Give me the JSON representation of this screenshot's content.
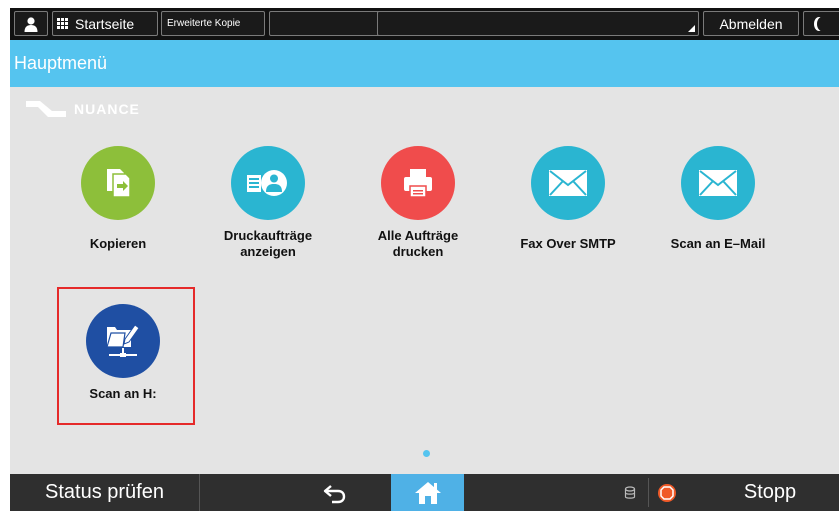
{
  "topbar": {
    "user_icon": "user-icon",
    "home_label": "Startseite",
    "copy_label": "Erweiterte Kopie",
    "logout_label": "Abmelden",
    "moon_icon": "moon-icon"
  },
  "header": {
    "title": "Hauptmenü"
  },
  "logo": {
    "text": "NUANCE"
  },
  "apps": [
    {
      "label": "Kopieren",
      "icon": "copy-icon",
      "color": "#8dbf3a"
    },
    {
      "label": "Druckaufträge\nanzeigen",
      "icon": "print-jobs-icon",
      "color": "#2ab5d1"
    },
    {
      "label": "Alle Aufträge\ndrucken",
      "icon": "printer-icon",
      "color": "#f04c4c"
    },
    {
      "label": "Fax Over SMTP",
      "icon": "envelope-icon",
      "color": "#2ab5d1"
    },
    {
      "label": "Scan an E–Mail",
      "icon": "envelope-icon",
      "color": "#2ab5d1"
    },
    {
      "label": "Scan an H:",
      "icon": "scan-folder-icon",
      "color": "#1f4fa3"
    }
  ],
  "bottombar": {
    "status_label": "Status prüfen",
    "back_icon": "back-arrow-icon",
    "home_icon": "home-icon",
    "db_icon": "database-icon",
    "stop_icon": "stop-icon",
    "stop_label": "Stopp"
  }
}
